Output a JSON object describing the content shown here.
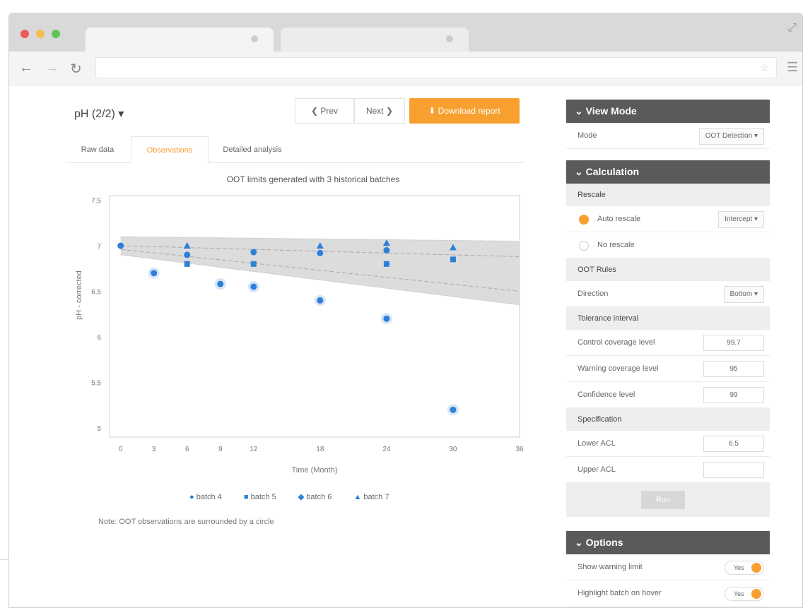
{
  "browser": {
    "address": "",
    "colors": {
      "close": "#ed5b57",
      "min": "#f5bd4f",
      "max": "#61c554"
    }
  },
  "header": {
    "title": "pH (2/2) ▾",
    "prev_label": "❮ Prev",
    "next_label": "Next ❯",
    "download_label": "⬇ Download report"
  },
  "tabs": [
    {
      "label": "Raw data"
    },
    {
      "label": "Observations"
    },
    {
      "label": "Detailed analysis"
    }
  ],
  "chart_data": {
    "type": "scatter",
    "title": "OOT limits generated with 3 historical batches",
    "xlabel": "Time (Month)",
    "ylabel": "pH - corrected",
    "xticks": [
      0,
      3,
      6,
      9,
      12,
      18,
      24,
      30,
      36
    ],
    "yticks": [
      7.5,
      7,
      6.5,
      6,
      5.5,
      5
    ],
    "xlim": [
      -1,
      36
    ],
    "ylim": [
      4.9,
      7.55
    ],
    "band_upper": [
      [
        0,
        7.1
      ],
      [
        36,
        7.05
      ]
    ],
    "band_lower": [
      [
        0,
        6.9
      ],
      [
        36,
        6.35
      ]
    ],
    "series": [
      {
        "name": "batch 4",
        "marker": "circle",
        "values": [
          [
            0,
            7.0
          ],
          [
            3,
            6.7
          ],
          [
            9,
            6.58
          ],
          [
            12,
            6.55
          ],
          [
            18,
            6.4
          ],
          [
            24,
            6.2
          ],
          [
            30,
            5.2
          ]
        ]
      },
      {
        "name": "batch 5",
        "marker": "square",
        "values": [
          [
            6,
            6.8
          ],
          [
            12,
            6.8
          ],
          [
            24,
            6.8
          ],
          [
            30,
            6.85
          ]
        ]
      },
      {
        "name": "batch 6",
        "marker": "circle",
        "values": [
          [
            6,
            6.9
          ],
          [
            12,
            6.93
          ],
          [
            18,
            6.92
          ],
          [
            24,
            6.95
          ]
        ]
      },
      {
        "name": "batch 7",
        "marker": "triangle",
        "values": [
          [
            6,
            7.0
          ],
          [
            18,
            7.0
          ],
          [
            24,
            7.03
          ],
          [
            30,
            6.98
          ]
        ]
      }
    ],
    "highlighted": [
      [
        3,
        6.7
      ],
      [
        9,
        6.58
      ],
      [
        12,
        6.55
      ],
      [
        18,
        6.4
      ],
      [
        24,
        6.2
      ],
      [
        30,
        5.2
      ]
    ],
    "color": "#2f7fd8"
  },
  "legend": [
    {
      "symbol": "●",
      "label": "batch 4"
    },
    {
      "symbol": "■",
      "label": "batch 5"
    },
    {
      "symbol": "◆",
      "label": "batch 6"
    },
    {
      "symbol": "▲",
      "label": "batch 7"
    }
  ],
  "note": "Note: OOT observations are surrounded by a circle",
  "sidebar": {
    "view_mode": {
      "header": "View Mode",
      "mode_label": "Mode",
      "mode_value": "OOT Detection ▾"
    },
    "calculation": {
      "header": "Calculation",
      "rescale_header": "Rescale",
      "auto_rescale": "Auto rescale",
      "auto_rescale_option": "Intercept ▾",
      "no_rescale": "No rescale",
      "oot_rules_header": "OOT Rules",
      "direction_label": "Direction",
      "direction_value": "Bottom ▾",
      "tolerance_header": "Tolerance interval",
      "control_label": "Control coverage level",
      "control_value": "99.7",
      "warning_label": "Warning coverage level",
      "warning_value": "95",
      "confidence_label": "Confidence level",
      "confidence_value": "99",
      "spec_header": "Specification",
      "lower_label": "Lower ACL",
      "lower_value": "6.5",
      "upper_label": "Upper ACL",
      "upper_value": "",
      "run_label": "Run"
    },
    "options": {
      "header": "Options",
      "show_warning_label": "Show warning limit",
      "show_warning_value": "Yes",
      "highlight_label": "Highlight batch on hover",
      "highlight_value": "Yes"
    }
  },
  "accent": "#f7a030",
  "panel_header_color": "#5a5a5a"
}
